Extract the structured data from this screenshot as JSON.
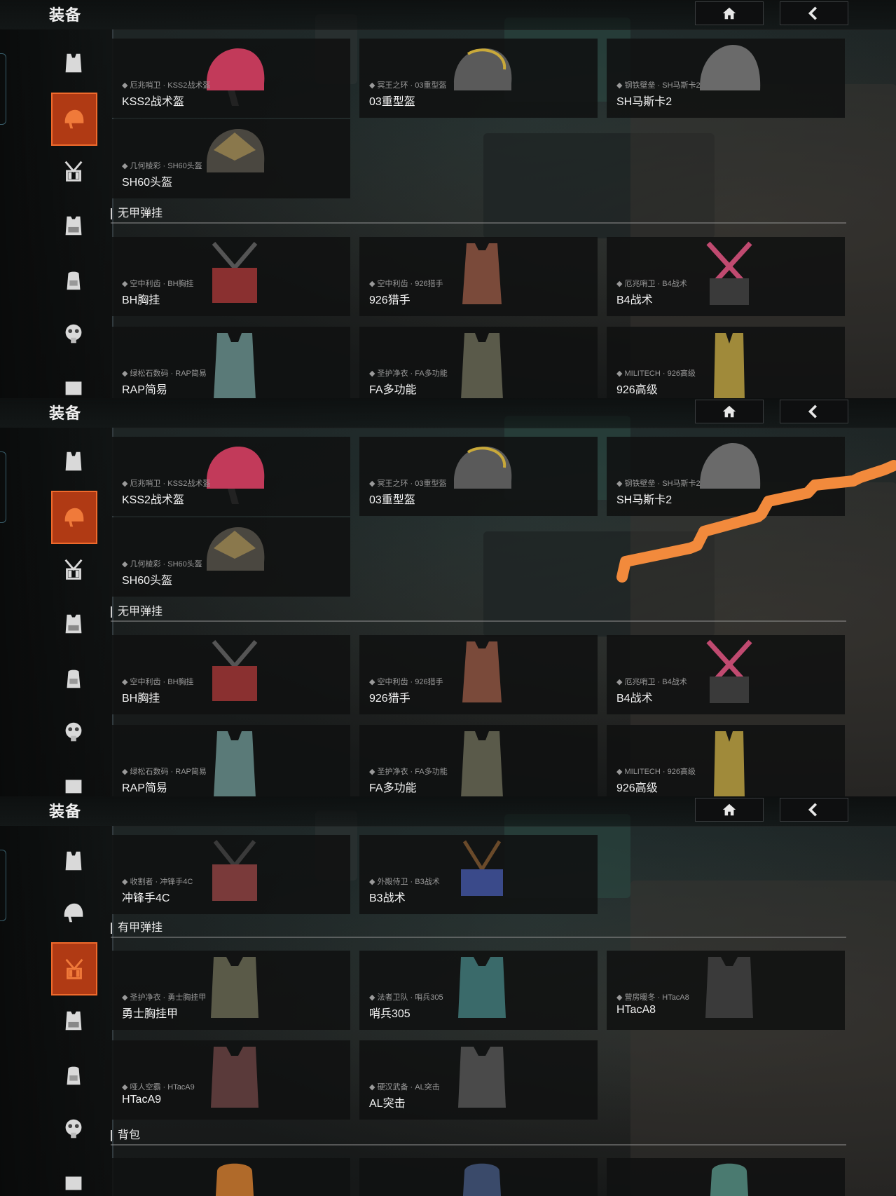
{
  "title": "装备",
  "nav": {
    "home_icon": "home-icon",
    "back_icon": "back-chevron-icon"
  },
  "sidebar_icons": [
    "vest-icon",
    "helmet-icon",
    "chest-rig-icon",
    "armored-rig-icon",
    "backpack-icon",
    "gas-mask-icon",
    "pouch-icon"
  ],
  "colors": {
    "accent": "#b03a14",
    "accent_border": "#ef6a2c",
    "stroke": "#f28a3c"
  },
  "sections": {
    "unarmored_rigs": "无甲弹挂",
    "armored_rigs": "有甲弹挂",
    "backpacks": "背包"
  },
  "helmets": [
    {
      "sub": "厄兆哨卫 · KSS2战术盔",
      "name": "KSS2战术盔",
      "color": "#c23a5a"
    },
    {
      "sub": "冥王之环 · 03重型盔",
      "name": "03重型盔",
      "color": "#5a5a5a"
    },
    {
      "sub": "钢铁壁垒 · SH马斯卡2",
      "name": "SH马斯卡2",
      "color": "#6a6a6a"
    },
    {
      "sub": "几何棱彩 · SH60头盔",
      "name": "SH60头盔",
      "color": "#4a4740"
    }
  ],
  "unarmored": [
    {
      "sub": "空中利齿 · BH胸挂",
      "name": "BH胸挂",
      "color": "#8a3030"
    },
    {
      "sub": "空中利齿 · 926猎手",
      "name": "926猎手",
      "color": "#7a4a3a"
    },
    {
      "sub": "厄兆哨卫 · B4战术",
      "name": "B4战术",
      "color": "#c04a70"
    },
    {
      "sub": "绿松石数码 · RAP简易",
      "name": "RAP简易",
      "color": "#5a7a78"
    },
    {
      "sub": "圣护净衣 · FA多功能",
      "name": "FA多功能",
      "color": "#5a5a4a"
    },
    {
      "sub": "MILITECH · 926高级",
      "name": "926高级",
      "color": "#a08a3a"
    }
  ],
  "panel3_top": [
    {
      "sub": "收割者 · 冲锋手4C",
      "name": "冲锋手4C",
      "color": "#7a3a3a"
    },
    {
      "sub": "外殿侍卫 · B3战术",
      "name": "B3战术",
      "color": "#3a4a8a"
    }
  ],
  "armored": [
    {
      "sub": "圣护净衣 · 勇士胸挂甲",
      "name": "勇士胸挂甲",
      "color": "#5a5a48"
    },
    {
      "sub": "法者卫队 · 哨兵305",
      "name": "哨兵305",
      "color": "#3a6a6a"
    },
    {
      "sub": "营房暖冬 · HTacA8",
      "name": "HTacA8",
      "color": "#3a3a3a"
    },
    {
      "sub": "哑人空霸 · HTacA9",
      "name": "HTacA9",
      "color": "#5a3a3a"
    },
    {
      "sub": "硬汉武备 · AL突击",
      "name": "AL突击",
      "color": "#4a4a4a"
    }
  ],
  "backpacks_row": [
    {
      "color": "#b06a2a"
    },
    {
      "color": "#3a4a6a"
    },
    {
      "color": "#4a7a70"
    }
  ]
}
